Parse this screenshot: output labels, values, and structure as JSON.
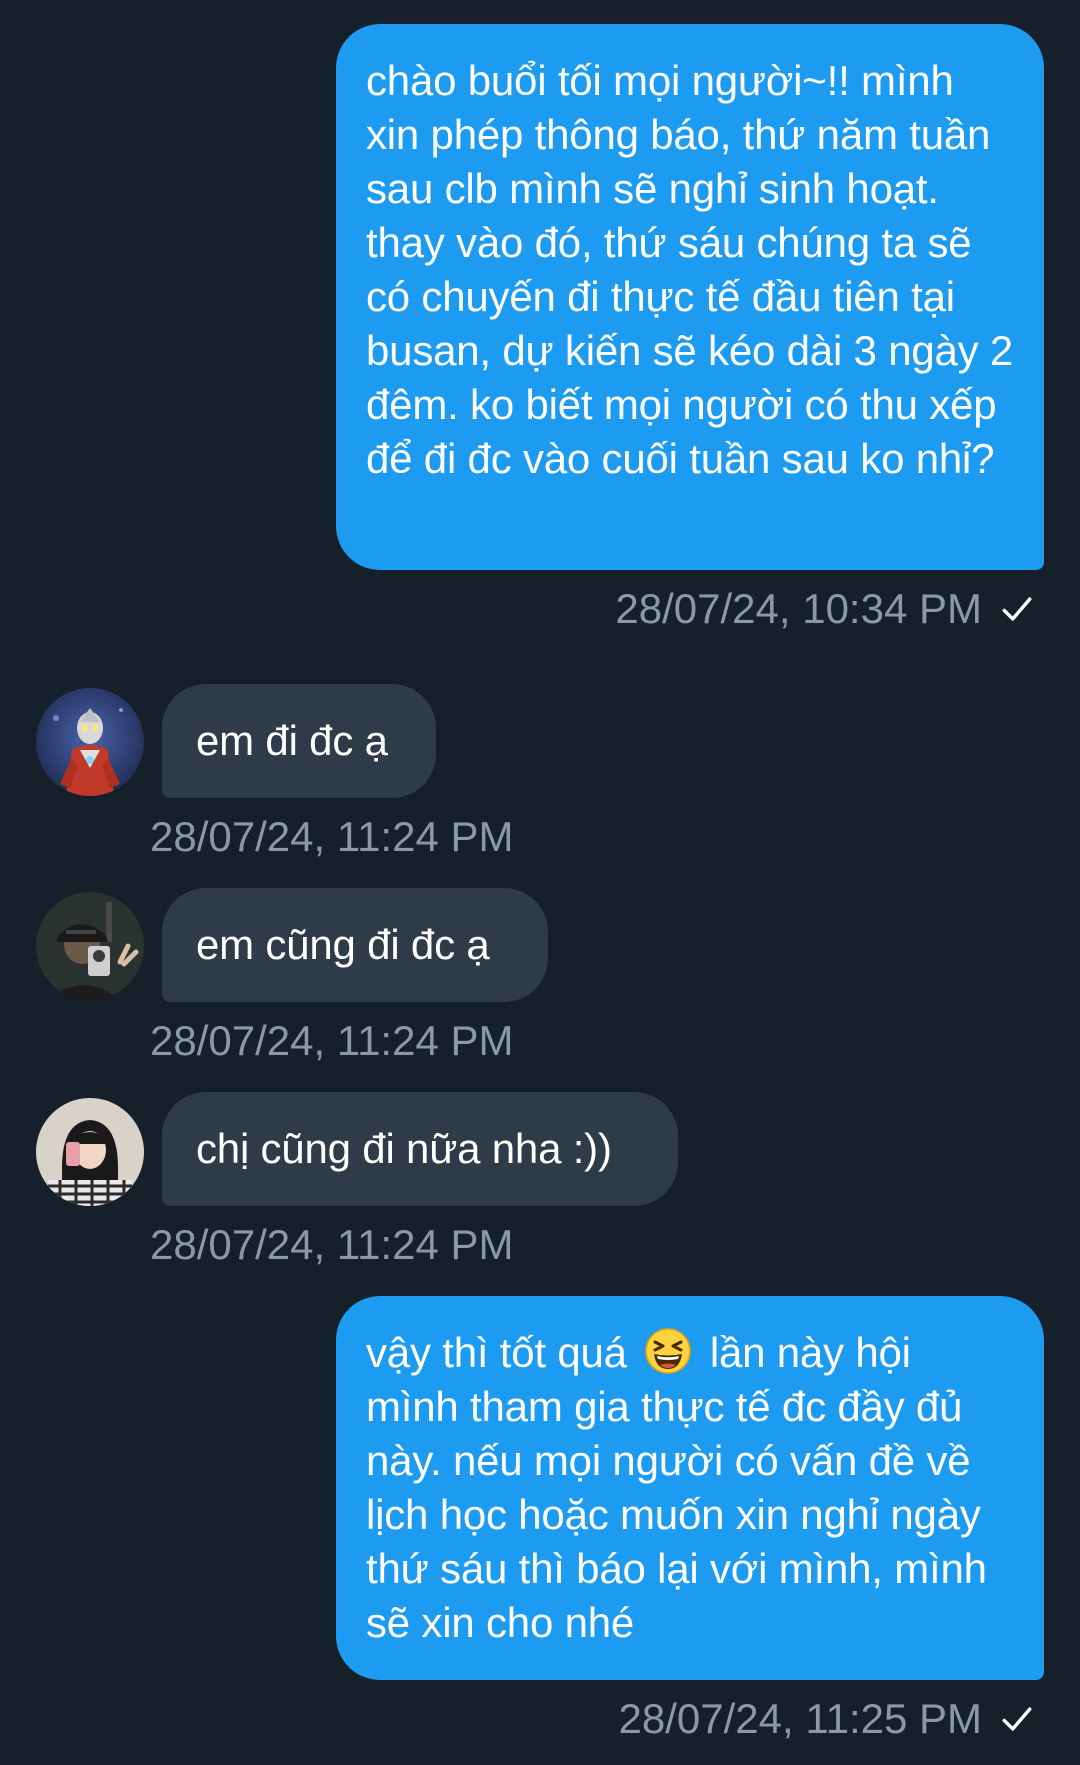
{
  "messages": [
    {
      "direction": "out",
      "text": "chào buổi tối mọi người~!! mình xin phép thông báo, thứ năm tuần sau clb mình sẽ nghỉ sinh hoạt. thay vào đó, thứ sáu chúng ta sẽ có chuyến đi thực tế đầu tiên tại busan, dự kiến sẽ kéo dài 3 ngày 2 đêm. ko biết mọi người có thu xếp để đi đc vào cuối tuần sau ko nhỉ?",
      "timestamp": "28/07/24, 10:34 PM"
    },
    {
      "direction": "in",
      "avatar_icon": "hero-figure-avatar-icon",
      "text": "em đi đc ạ",
      "timestamp": "28/07/24, 11:24 PM"
    },
    {
      "direction": "in",
      "avatar_icon": "cap-selfie-avatar-icon",
      "text": "em cũng đi đc ạ",
      "timestamp": "28/07/24, 11:24 PM"
    },
    {
      "direction": "in",
      "avatar_icon": "girl-selfie-avatar-icon",
      "text": "chị cũng đi nữa nha :))",
      "timestamp": "28/07/24, 11:24 PM"
    },
    {
      "direction": "out",
      "text_before": "vậy thì tốt quá",
      "emoji_icon": "grinning-squinting-face-icon",
      "text_after": "lần này hội mình tham gia thực tế đc đầy đủ này. nếu mọi người có vấn đề về lịch học hoặc muốn xin nghỉ ngày thứ sáu thì báo lại với mình, mình sẽ xin cho nhé",
      "timestamp": "28/07/24, 11:25 PM"
    }
  ],
  "colors": {
    "background": "#15202b",
    "outgoing_bubble": "#1d9bf0",
    "incoming_bubble": "#2f3b48",
    "timestamp": "#8b98a5"
  },
  "icons": {
    "sent_status": "checkmark-icon"
  }
}
